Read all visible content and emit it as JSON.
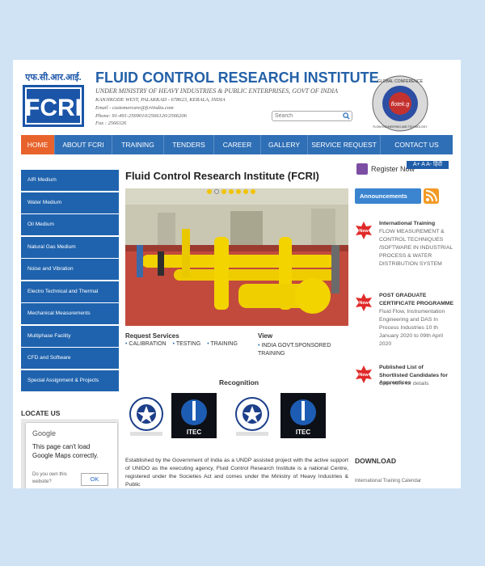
{
  "header": {
    "logo_hindi": "एफ.सी.आर.आई.",
    "logo_text": "FCRI",
    "title": "FLUID CONTROL RESEARCH INSTITUTE",
    "subtitle": "UNDER MINISTRY OF HEAVY INDUSTRIES & PUBLIC ENTERPRISES, GOVT OF INDIA",
    "address": "KANJIKODE WEST, PALAKKAD - 678623, KERALA, INDIA",
    "email": "Email - customercare@fcriindia.com",
    "phone": "Phone: 91-491-2569010/2566120/2566206",
    "fax": "Fax : 2566326",
    "search_placeholder": "Search",
    "badge_top": "GLOBAL CONFERENCE",
    "badge_center": "flotek.g",
    "badge_bottom": "FLOW ENGINEERING AND TECHNOLOGY"
  },
  "nav": {
    "items": [
      {
        "label": "HOME"
      },
      {
        "label": "ABOUT FCRI"
      },
      {
        "label": "TRAINING"
      },
      {
        "label": "TENDERS"
      },
      {
        "label": "CAREER"
      },
      {
        "label": "GALLERY"
      },
      {
        "label": "SERVICE REQUEST"
      },
      {
        "label": "CONTACT US"
      }
    ]
  },
  "sidebar": {
    "items": [
      {
        "label": "AIR Medium"
      },
      {
        "label": "Water Medium"
      },
      {
        "label": "Oil Medium"
      },
      {
        "label": "Natural Gas Medium"
      },
      {
        "label": "Noise and Vibration"
      },
      {
        "label": "Electro Technical and Thermal"
      },
      {
        "label": "Mechanical Measurements"
      },
      {
        "label": "Multiphase Facility"
      },
      {
        "label": "CFD and Software"
      },
      {
        "label": "Special Assignment & Projects"
      }
    ],
    "locate_heading": "LOCATE US",
    "map": {
      "brand": "Google",
      "message": "This page can't load Google Maps correctly.",
      "question": "Do you own this website?",
      "ok_label": "OK"
    }
  },
  "main": {
    "title": "Fluid Control Research Institute (FCRI)",
    "request_heading": "Request Services",
    "request_items": [
      "CALIBRATION",
      "TESTING",
      "TRAINING"
    ],
    "view_heading": "View",
    "view_item": "INDIA GOVT.SPONSORED TRAINING",
    "recognition_heading": "Recognition",
    "itec_label": "ITEC",
    "paragraph": "Established by the Government of India as a UNDP assisted project with the active support of UNIDO as the executing agency, Fluid Control Research Institute is a national Centre, registered under the Societies Act and comes under the Ministry of Heavy Industries & Public"
  },
  "right": {
    "register_label": "Register Now",
    "font_controls": "A+ A A- हिंदी",
    "announcements_label": "Announcements",
    "new_badge": "New",
    "news": [
      {
        "title": "International Training",
        "body": "FLOW MEASUREMENT & CONTROL TECHNIQUES /SOFTWARE IN INDUSTRIAL PROCESS & WATER DISTRIBUTION SYSTEM"
      },
      {
        "title": "POST GRADUATE CERTIFICATE PROGRAMME",
        "body": "Fluid Flow, Instrumentation Engineering and DAS In Process Industries 10 th January 2020 to 09th April 2020"
      },
      {
        "title": "Published List of Shortlisted Candidates for Apprentices",
        "body": "Click here for details"
      }
    ],
    "download_heading": "DOWNLOAD",
    "download_item": "International Training Calendar"
  },
  "colors": {
    "nav_blue": "#2f6fb6",
    "nav_active": "#e8632b",
    "sidebar_blue": "#1f63ae",
    "title_blue": "#2461a8"
  }
}
